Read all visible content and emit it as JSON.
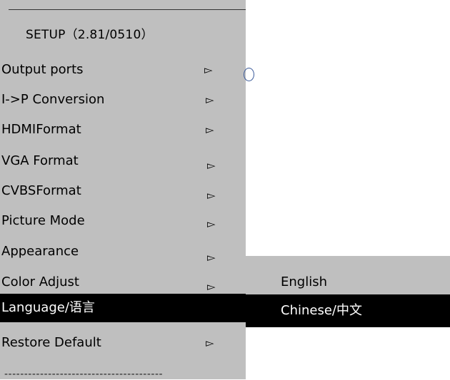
{
  "setup_menu": {
    "title": "SETUP（2.81/0510）",
    "items": [
      {
        "label": "Output ports",
        "arrow": "▻"
      },
      {
        "label": "I->P Conversion",
        "arrow": "▻"
      },
      {
        "label": "HDMIFormat",
        "arrow": "▻"
      },
      {
        "label": "VGA Format",
        "arrow": "▻"
      },
      {
        "label": "CVBSFormat",
        "arrow": "▻"
      },
      {
        "label": "Picture Mode",
        "arrow": "▻"
      },
      {
        "label": "Appearance",
        "arrow": "▻"
      },
      {
        "label": "Color Adjust",
        "arrow": "▻"
      },
      {
        "label": "Language/语言",
        "arrow": ""
      },
      {
        "label": "Restore Default",
        "arrow": "▻"
      }
    ],
    "selected_index": 8,
    "footer": "----------------------------------------"
  },
  "language_submenu": {
    "items": [
      {
        "label": "English"
      },
      {
        "label": "Chinese/中文"
      }
    ],
    "selected_index": 1
  },
  "colors": {
    "menu_background": "#bfbfbf",
    "selection_background": "#000000",
    "selection_text": "#ffffff"
  }
}
